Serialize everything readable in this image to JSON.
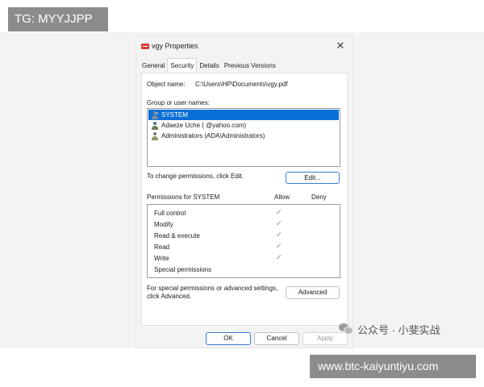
{
  "overlay": {
    "top_tag": "TG: MYYJJPP",
    "bottom_tag": "www.btc-kaiyuntiyu.com",
    "watermark": "公众号 · 小斐实战"
  },
  "window": {
    "title": "vgy Properties",
    "close_symbol": "✕"
  },
  "tabs": [
    {
      "label": "General"
    },
    {
      "label": "Security",
      "active": true
    },
    {
      "label": "Details"
    },
    {
      "label": "Previous Versions"
    }
  ],
  "security": {
    "object_name_label": "Object name:",
    "object_name_value": "C:\\Users\\HP\\Documents\\vgy.pdf",
    "group_label": "Group or user names:",
    "users": [
      {
        "name": "SYSTEM",
        "icon": "group-icon",
        "selected": true
      },
      {
        "name": "Adaeze Uche (                     @yahoo.com)",
        "icon": "user-icon",
        "selected": false
      },
      {
        "name": "Administrators (ADA\\Administrators)",
        "icon": "admin-group-icon",
        "selected": false
      }
    ],
    "change_text": "To change permissions, click Edit.",
    "edit_button": "Edit...",
    "permissions_title": "Permissions for SYSTEM",
    "allow_header": "Allow",
    "deny_header": "Deny",
    "permissions": [
      {
        "name": "Full control",
        "allow": true,
        "deny": false
      },
      {
        "name": "Modify",
        "allow": true,
        "deny": false
      },
      {
        "name": "Read & execute",
        "allow": true,
        "deny": false
      },
      {
        "name": "Read",
        "allow": true,
        "deny": false
      },
      {
        "name": "Write",
        "allow": true,
        "deny": false
      },
      {
        "name": "Special permissions",
        "allow": false,
        "deny": false
      }
    ],
    "advanced_text_line1": "For special permissions or advanced settings,",
    "advanced_text_line2": "click Advanced.",
    "advanced_button": "Advanced"
  },
  "footer": {
    "ok": "OK",
    "cancel": "Cancel",
    "apply": "Apply"
  },
  "check_symbol": "✓"
}
